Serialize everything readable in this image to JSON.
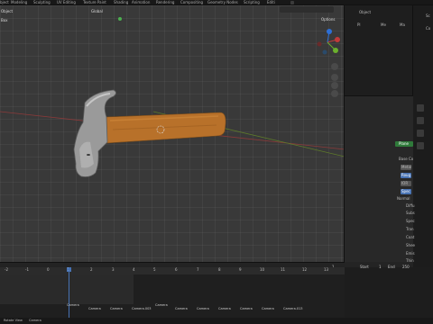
{
  "topbar": {
    "tabs": [
      "bject",
      "Modeling",
      "Sculpting",
      "UV Editing",
      "Texture Paint",
      "Shading",
      "Animation",
      "Rendering",
      "Compositing",
      "Geometry Nodes",
      "Scripting",
      "Editi"
    ]
  },
  "viewport": {
    "mode_label": "Object",
    "collection_label": "Box",
    "transform_label": "Global",
    "options_label": "Options"
  },
  "outliner": {
    "header_object": "Object",
    "rows": [
      "Pl",
      "Me",
      "Ma",
      "Sc",
      "Co"
    ]
  },
  "properties": {
    "highlight": "Plane",
    "rows": [
      "Base Co",
      "Metal",
      "Roug",
      "IOR",
      "Spec",
      "Normal",
      "Diffu",
      "Subs",
      "Spec",
      "Tran",
      "Coat",
      "Shee",
      "Emis",
      "Thin"
    ]
  },
  "timeline": {
    "ruler": [
      "-2",
      "-1",
      "0",
      "1",
      "2",
      "3",
      "4",
      "5",
      "6",
      "7",
      "8",
      "9",
      "10",
      "11",
      "12",
      "13"
    ],
    "current_frame": "1",
    "start_label": "Start",
    "start_value": "1",
    "end_label": "End",
    "end_value": "250",
    "frame_field": "1",
    "markers": [
      "Camera",
      "Camera",
      "Camera",
      "Camera.003",
      "Camera",
      "Camera",
      "Camera",
      "Camera",
      "Camera",
      "Camera",
      "Camera.013"
    ]
  },
  "statusbar": {
    "left": "Rotate View",
    "right": "Camera"
  },
  "colors": {
    "accent": "#4772b3",
    "hammer_handle": "#b8712a",
    "hammer_head": "#9a9a9a"
  }
}
